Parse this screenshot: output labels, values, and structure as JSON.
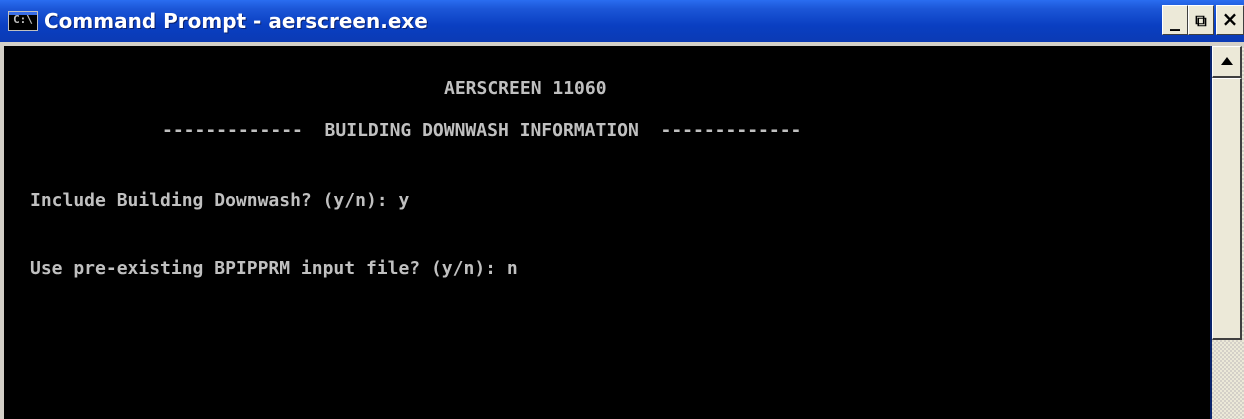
{
  "window": {
    "title": "Command Prompt - aerscreen.exe",
    "icon_glyph": "C:\\",
    "controls": {
      "minimize": "_",
      "restore": "⧉",
      "close": "×"
    }
  },
  "console": {
    "lines": [
      "AERSCREEN 11060",
      "-------------  BUILDING DOWNWASH INFORMATION  -------------",
      "Include Building Downwash? (y/n): y",
      "Use pre-existing BPIPPRM input file? (y/n): n"
    ],
    "colors": {
      "background": "#000000",
      "text": "#c0c0c0"
    }
  }
}
